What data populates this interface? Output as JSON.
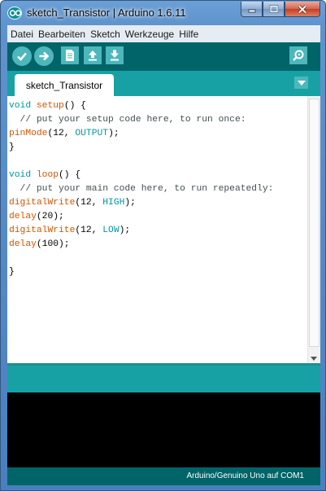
{
  "window": {
    "title": "sketch_Transistor | Arduino 1.6.11",
    "icon": "arduino-logo-icon",
    "buttons": [
      "minimize-icon",
      "maximize-icon",
      "close-icon"
    ]
  },
  "menu": {
    "items": [
      "Datei",
      "Bearbeiten",
      "Sketch",
      "Werkzeuge",
      "Hilfe"
    ]
  },
  "toolbar": {
    "buttons": [
      "verify-icon",
      "upload-icon",
      "new-icon",
      "open-icon",
      "save-icon",
      "serial-monitor-icon"
    ]
  },
  "tabs": [
    {
      "label": "sketch_Transistor",
      "active": true
    }
  ],
  "editor": {
    "lines": [
      "void setup() {",
      "  // put your setup code here, to run once:",
      "pinMode(12, OUTPUT);",
      "}",
      "",
      "void loop() {",
      "  // put your main code here, to run repeatedly:",
      "digitalWrite(12, HIGH);",
      "delay(20);",
      "digitalWrite(12, LOW);",
      "delay(100);",
      "",
      "}"
    ]
  },
  "console": {
    "text": ""
  },
  "footer": {
    "board_info": "Arduino/Genuino Uno auf COM1"
  },
  "colors": {
    "teal": "#17a1a5",
    "dark_teal": "#006468",
    "keyword": "#00979c",
    "function": "#d35400",
    "comment": "#434f54"
  }
}
